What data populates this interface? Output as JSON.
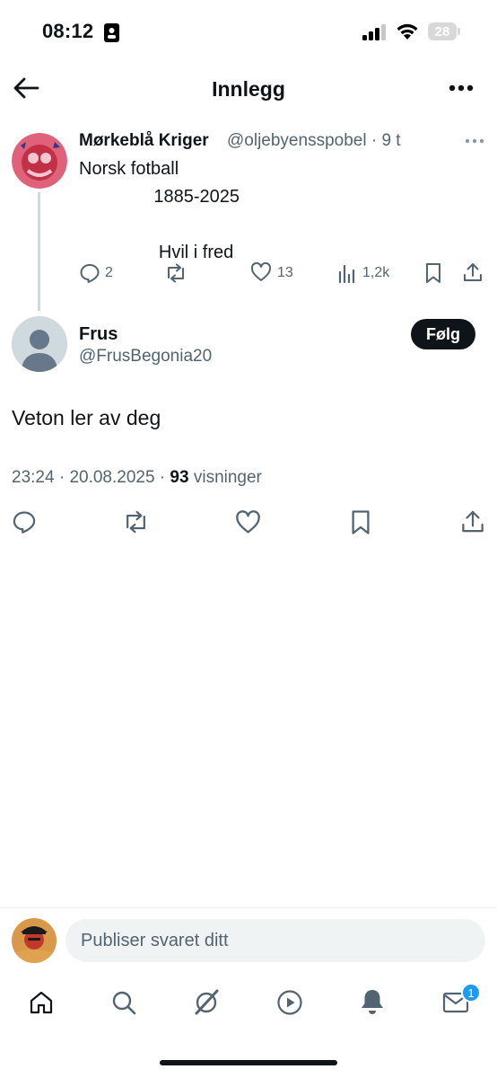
{
  "status_bar": {
    "time": "08:12",
    "battery": "28"
  },
  "header": {
    "title": "Innlegg"
  },
  "parent_post": {
    "author_name": "Mørkeblå Kriger",
    "handle_time": "@oljebyensspobel · 9 t",
    "text": "Norsk fotball\n               1885-2025\n\n                Hvil i fred",
    "replies": "2",
    "likes": "13",
    "views": "1,2k"
  },
  "main_post": {
    "author_name": "Frus",
    "handle": "@FrusBegonia20",
    "follow_label": "Følg",
    "text": "Veton ler av deg",
    "time": "23:24",
    "date": "20.08.2025",
    "views_count": "93",
    "views_label": "visninger"
  },
  "reply_bar": {
    "placeholder": "Publiser svaret ditt"
  },
  "bottom_nav": {
    "items": [
      "home-icon",
      "search-icon",
      "grok-icon",
      "video-icon",
      "notifications-icon",
      "messages-icon"
    ],
    "messages_badge": "1"
  },
  "colors": {
    "accent": "#1d9bf0",
    "secondary_text": "#536471",
    "primary_text": "#0f1419"
  }
}
